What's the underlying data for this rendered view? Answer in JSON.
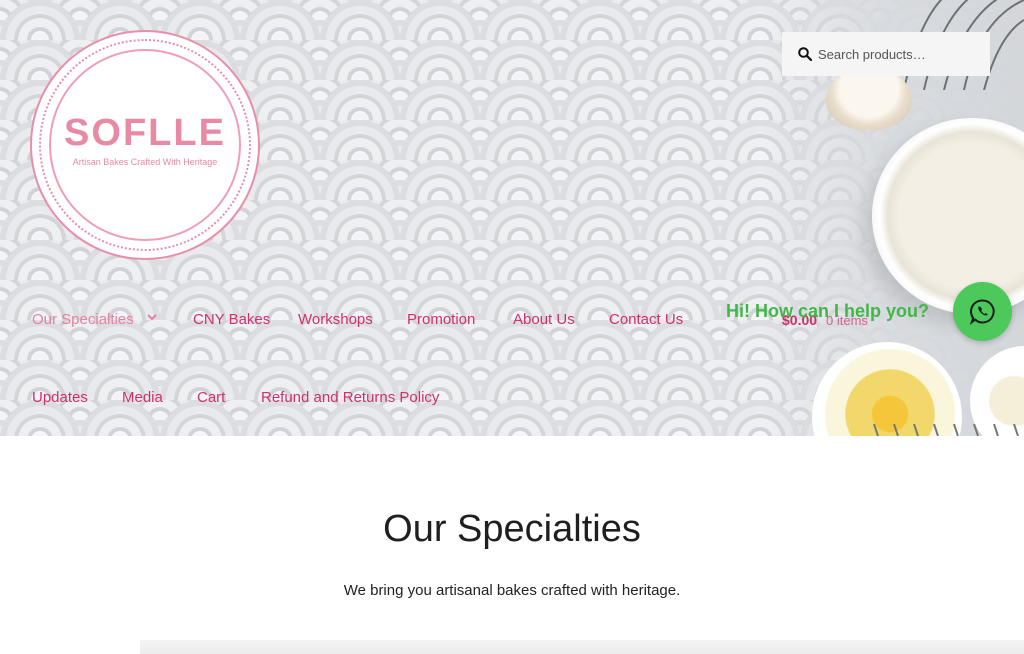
{
  "brand": {
    "name": "SOFLLE",
    "tagline": "Artisan Bakes Crafted With Heritage"
  },
  "search": {
    "placeholder": "Search products…",
    "icon": "search-icon"
  },
  "nav": {
    "items": [
      {
        "label": "Our Specialties",
        "active": true,
        "has_dropdown": true
      },
      {
        "label": "CNY Bakes"
      },
      {
        "label": "Workshops"
      },
      {
        "label": "Promotion"
      },
      {
        "label": "About Us"
      },
      {
        "label": "Contact Us"
      },
      {
        "label": "Updates"
      },
      {
        "label": "Media"
      },
      {
        "label": "Cart"
      },
      {
        "label": "Refund and Returns Policy"
      }
    ]
  },
  "cart": {
    "total": "$0.00",
    "count": "0 items"
  },
  "chat": {
    "prompt": "Hi! How can I help you?",
    "icon": "whatsapp-icon"
  },
  "page": {
    "title": "Our Specialties",
    "subtitle": "We bring you artisanal bakes crafted with heritage."
  },
  "colors": {
    "nav_link": "#d0306e",
    "nav_active": "#e6819f",
    "logo_pink": "#e88aa3",
    "chat_green": "#4cc95a"
  }
}
